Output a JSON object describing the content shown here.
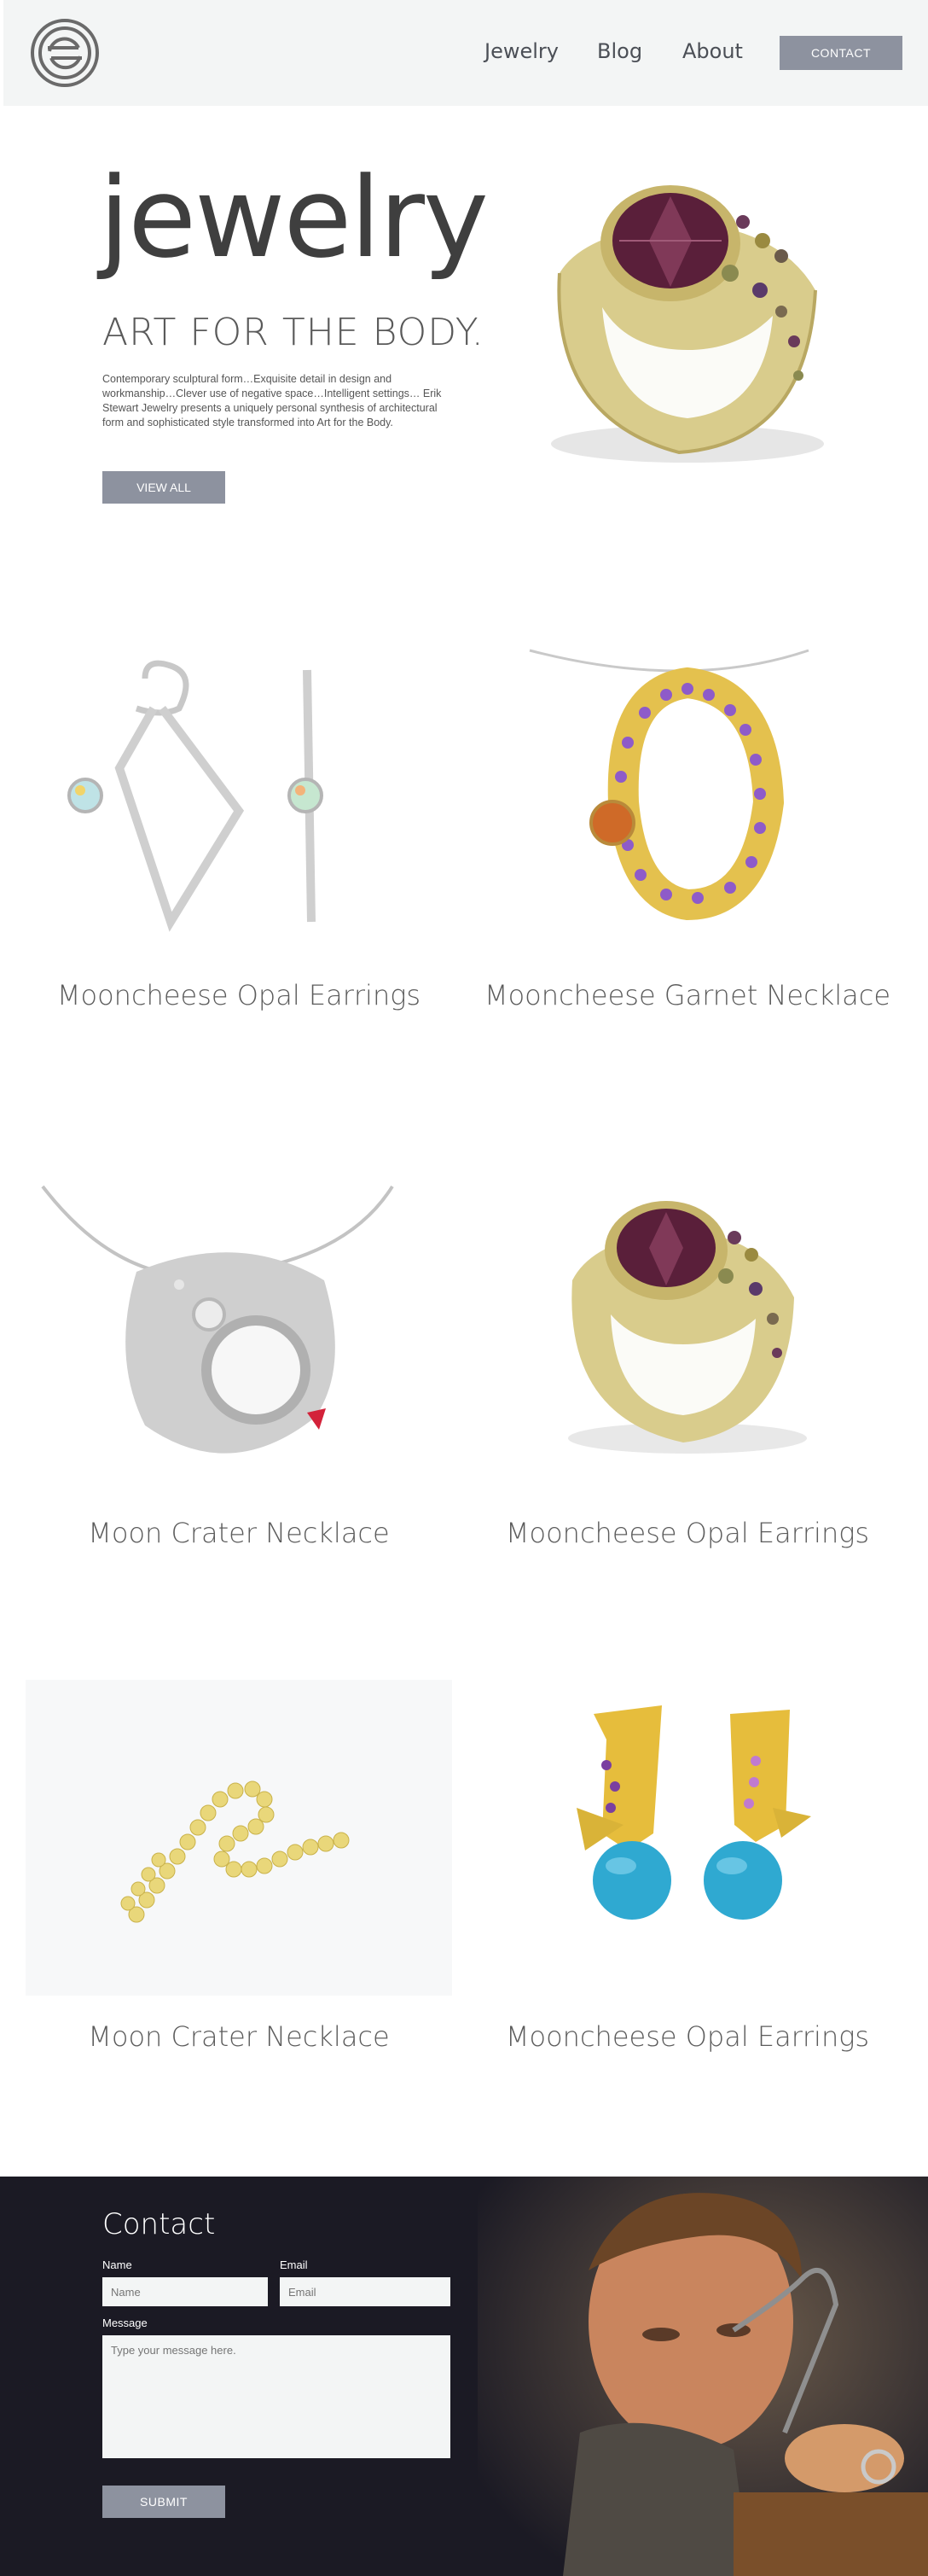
{
  "nav": {
    "jewelry": "Jewelry",
    "blog": "Blog",
    "about": "About",
    "contact": "CONTACT"
  },
  "hero": {
    "title": "jewelry",
    "subtitle": "ART FOR THE BODY.",
    "description": "Contemporary sculptural form…Exquisite detail in design and workmanship…Clever use of negative space…Intelligent settings… Erik Stewart Jewelry presents a uniquely personal synthesis of architectural form and sophisticated style transformed into Art for the Body.",
    "view_all": "VIEW ALL"
  },
  "products": [
    {
      "name": "Mooncheese Opal Earrings",
      "icon": "opal-hoop-earrings"
    },
    {
      "name": "Mooncheese Garnet Necklace",
      "icon": "garnet-pendant-necklace"
    },
    {
      "name": "Moon Crater Necklace",
      "icon": "silver-crater-pendant"
    },
    {
      "name": "Mooncheese Opal Earrings",
      "icon": "gold-gemstone-ring"
    },
    {
      "name": "Moon Crater Necklace",
      "icon": "gold-chain-bracelet"
    },
    {
      "name": "Mooncheese Opal Earrings",
      "icon": "turquoise-drop-earrings"
    }
  ],
  "contact": {
    "title": "Contact",
    "name_label": "Name",
    "name_placeholder": "Name",
    "email_label": "Email",
    "email_placeholder": "Email",
    "message_label": "Message",
    "message_placeholder": "Type your message here.",
    "submit": "SUBMIT"
  },
  "colors": {
    "button": "#8d929f",
    "header_bg": "#f3f5f5",
    "footer_bg": "#1b1a24"
  }
}
